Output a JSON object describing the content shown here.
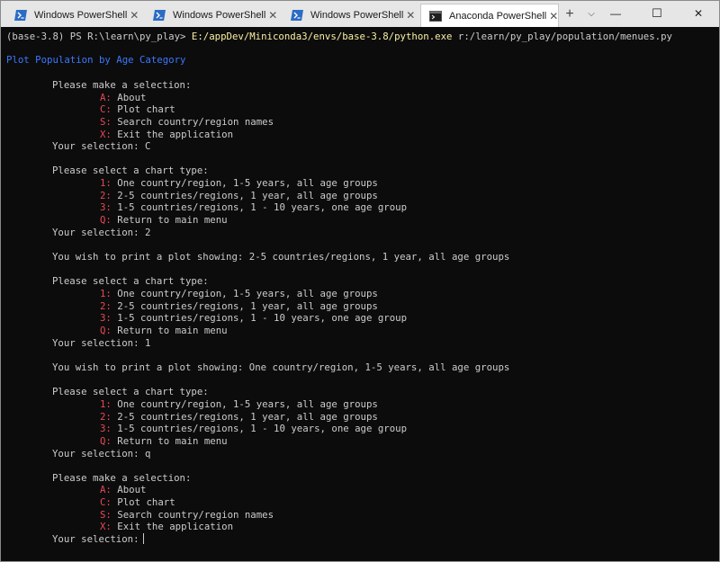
{
  "tabs": [
    {
      "title": "Windows PowerShell",
      "icon": "powershell-icon",
      "active": false
    },
    {
      "title": "Windows PowerShell",
      "icon": "powershell-icon",
      "active": false
    },
    {
      "title": "Windows PowerShell",
      "icon": "powershell-icon",
      "active": false
    },
    {
      "title": "Anaconda PowerShell",
      "icon": "terminal-icon",
      "active": true
    }
  ],
  "titlebar": {
    "close_tab_glyph": "✕",
    "new_tab_glyph": "+",
    "dropdown_glyph": "⌵",
    "minimize_glyph": "—",
    "maximize_glyph": "☐",
    "close_glyph": "✕"
  },
  "colors": {
    "background": "#0c0c0c",
    "text": "#cccccc",
    "menu_key": "#e74856",
    "command": "#f9f1a5",
    "heading": "#3b78ff"
  },
  "console": {
    "prompt": "(base-3.8) PS R:\\learn\\py_play> ",
    "command": "E:/appDev/Miniconda3/envs/base-3.8/python.exe",
    "argument": " r:/learn/py_play/population/menues.py",
    "heading": "Plot Population by Age Category",
    "main_menu_prompt": "Please make a selection:",
    "main_menu": [
      {
        "key": "A:",
        "text": " About"
      },
      {
        "key": "C:",
        "text": " Plot chart"
      },
      {
        "key": "S:",
        "text": " Search country/region names"
      },
      {
        "key": "X:",
        "text": " Exit the application"
      }
    ],
    "chart_menu_prompt": "Please select a chart type:",
    "chart_menu": [
      {
        "key": "1:",
        "text": " One country/region, 1-5 years, all age groups"
      },
      {
        "key": "2:",
        "text": " 2-5 countries/regions, 1 year, all age groups"
      },
      {
        "key": "3:",
        "text": " 1-5 countries/regions, 1 - 10 years, one age group"
      },
      {
        "key": "Q:",
        "text": " Return to main menu"
      }
    ],
    "selection_1": "Your selection: C",
    "selection_2": "Your selection: 2",
    "wish_1": "You wish to print a plot showing: 2-5 countries/regions, 1 year, all age groups",
    "selection_3": "Your selection: 1",
    "wish_2": "You wish to print a plot showing: One country/region, 1-5 years, all age groups",
    "selection_4": "Your selection: q",
    "selection_final": "Your selection:"
  }
}
